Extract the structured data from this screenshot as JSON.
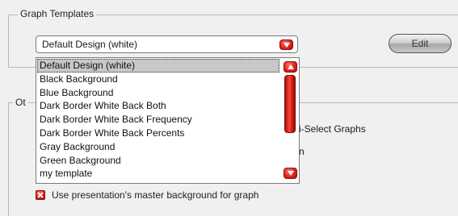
{
  "graph_templates": {
    "legend": "Graph Templates",
    "selected_value": "Default Design (white)",
    "edit_label": "Edit"
  },
  "dropdown_list": {
    "items": [
      "Default Design (white)",
      "Black Background",
      "Blue Background",
      "Dark Border White Back Both",
      "Dark Border White Back Frequency",
      "Dark Border White Back Percents",
      "Gray Background",
      "Green Background",
      "my template"
    ],
    "selected_index": 0
  },
  "other_group": {
    "legend": "Ot",
    "multi_select_text": "i-Select Graphs",
    "partial_text": "n"
  },
  "master_background": {
    "label": "Use presentation's master background for graph",
    "checked": true
  },
  "colors": {
    "accent_red": "#e0251c",
    "selection_gray": "#c8c8c8",
    "background": "#f0f0f0"
  }
}
